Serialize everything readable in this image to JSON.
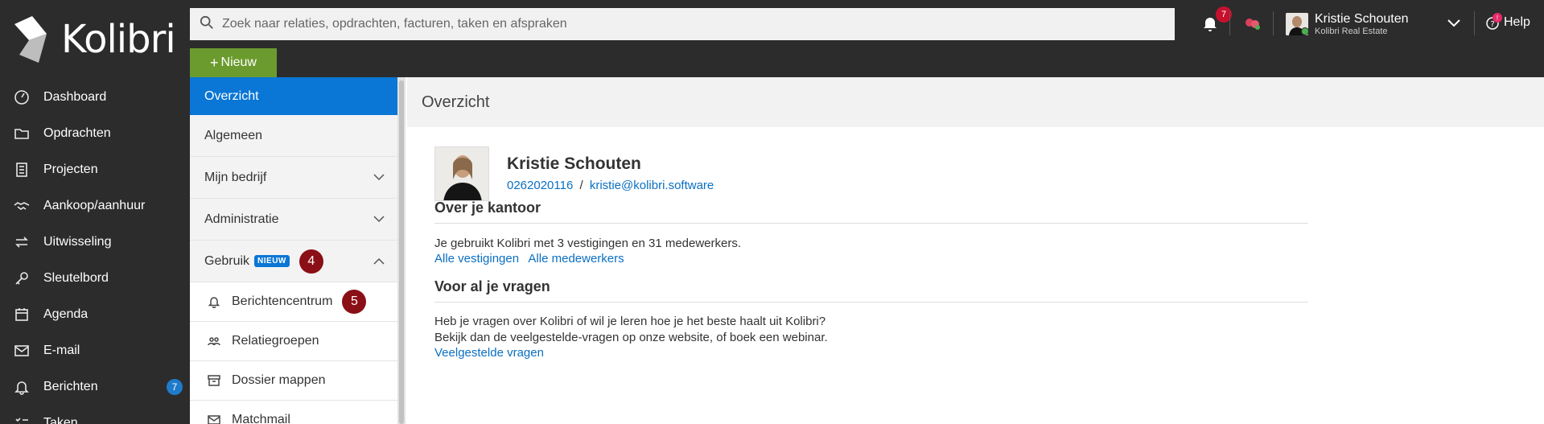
{
  "app": {
    "name": "Kolibri"
  },
  "sidebar": {
    "items": [
      {
        "label": "Dashboard",
        "icon": "dashboard-icon"
      },
      {
        "label": "Opdrachten",
        "icon": "folder-icon"
      },
      {
        "label": "Projecten",
        "icon": "building-icon"
      },
      {
        "label": "Aankoop/aanhuur",
        "icon": "handshake-icon"
      },
      {
        "label": "Uitwisseling",
        "icon": "exchange-icon"
      },
      {
        "label": "Sleutelbord",
        "icon": "key-icon"
      },
      {
        "label": "Agenda",
        "icon": "calendar-icon"
      },
      {
        "label": "E-mail",
        "icon": "mail-icon"
      },
      {
        "label": "Berichten",
        "icon": "bell-icon",
        "badge": "7"
      },
      {
        "label": "Taken",
        "icon": "tasks-icon"
      }
    ]
  },
  "topbar": {
    "search_placeholder": "Zoek naar relaties, opdrachten, facturen, taken en afspraken",
    "new_button": "Nieuw",
    "notifications_count": "7",
    "user_name": "Kristie Schouten",
    "user_company": "Kolibri Real Estate",
    "help_label": "Help",
    "help_badge": "!"
  },
  "submenu": {
    "overzicht": "Overzicht",
    "algemeen": "Algemeen",
    "mijn_bedrijf": "Mijn bedrijf",
    "administratie": "Administratie",
    "gebruik": "Gebruik",
    "gebruik_badge": "NIEUW",
    "gebruik_step": "4",
    "children": [
      {
        "label": "Berichtencentrum",
        "icon": "bell-icon",
        "step": "5"
      },
      {
        "label": "Relatiegroepen",
        "icon": "users-icon"
      },
      {
        "label": "Dossier mappen",
        "icon": "archive-icon"
      },
      {
        "label": "Matchmail",
        "icon": "mail-icon"
      }
    ]
  },
  "main": {
    "title": "Overzicht",
    "profile": {
      "name": "Kristie Schouten",
      "phone": "0262020116",
      "separator": "/",
      "email": "kristie@kolibri.software"
    },
    "office": {
      "heading": "Over je kantoor",
      "text": "Je gebruikt Kolibri met 3 vestigingen en 31 medewerkers.",
      "link1": "Alle vestigingen",
      "link2": "Alle medewerkers"
    },
    "questions": {
      "heading": "Voor al je vragen",
      "line1": "Heb je vragen over Kolibri of wil je leren hoe je het beste haalt uit Kolibri?",
      "line2": "Bekijk dan de veelgestelde-vragen op onze website, of boek een webinar.",
      "link": "Veelgestelde vragen"
    }
  }
}
